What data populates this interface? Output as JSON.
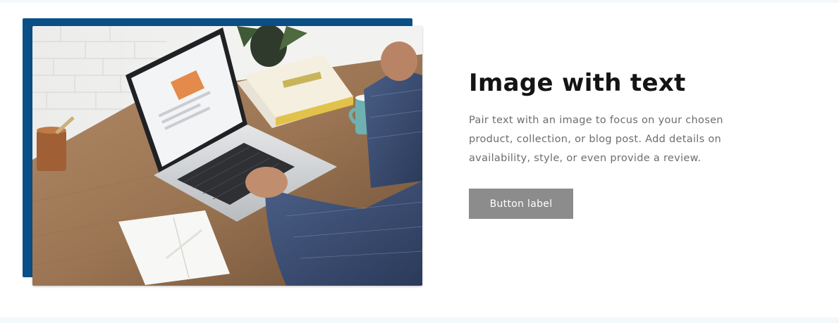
{
  "section": {
    "heading": "Image with text",
    "body": "Pair text with an image to focus on your chosen product, collection, or blog post. Add details on availability, style, or even provide a review.",
    "button_label": "Button label"
  },
  "image": {
    "alt": "Person typing on a laptop at a wooden desk",
    "accent_color": "#0a4f86"
  },
  "colors": {
    "heading": "#141414",
    "body_text": "#6d6d6d",
    "button_bg": "#8c8c8c",
    "button_text": "#ffffff"
  }
}
